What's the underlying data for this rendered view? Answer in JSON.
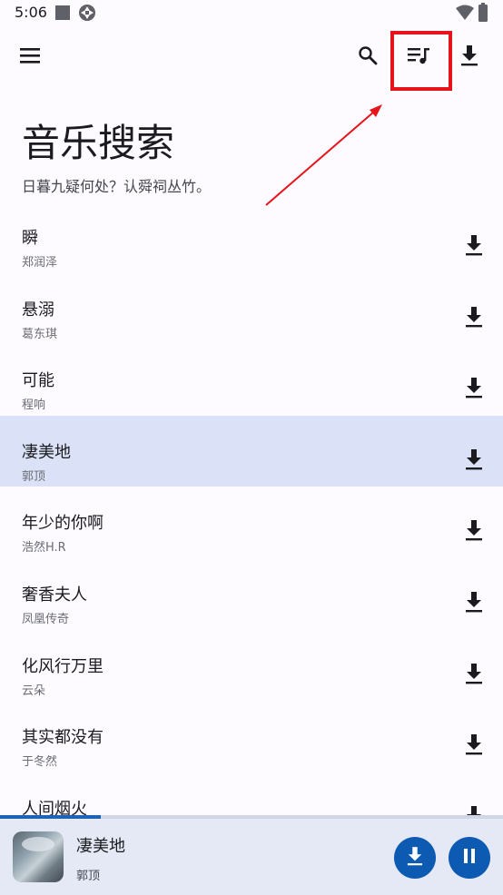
{
  "status_bar": {
    "time": "5:06",
    "icons": [
      "square-icon",
      "vpn-icon",
      "wifi-icon",
      "battery-icon"
    ]
  },
  "app_bar": {
    "icons": [
      "menu-icon",
      "search-icon",
      "queue-music-icon",
      "download-icon"
    ]
  },
  "page": {
    "title": "音乐搜索",
    "subtitle": "日暮九疑何处？认舜祠丛竹。"
  },
  "songs": [
    {
      "title": "瞬",
      "artist": "郑润泽"
    },
    {
      "title": "悬溺",
      "artist": "葛东琪"
    },
    {
      "title": "可能",
      "artist": "程响"
    },
    {
      "title": "凄美地",
      "artist": "郭顶",
      "selected": true
    },
    {
      "title": "年少的你啊",
      "artist": "浩然H.R"
    },
    {
      "title": "奢香夫人",
      "artist": "凤凰传奇"
    },
    {
      "title": "化风行万里",
      "artist": "云朵"
    },
    {
      "title": "其实都没有",
      "artist": "于冬然"
    },
    {
      "title": "人间烟火",
      "artist": ""
    }
  ],
  "player": {
    "title": "凄美地",
    "artist": "郭顶",
    "progress": 0.2,
    "icons": [
      "album-art",
      "download-icon",
      "pause-icon"
    ]
  },
  "colors": {
    "background": "#fdfbff",
    "selected_row": "#dbe2f7",
    "player_bar": "#e4e9f5",
    "accent": "#0d5ab3",
    "annotation": "#e5141b"
  }
}
